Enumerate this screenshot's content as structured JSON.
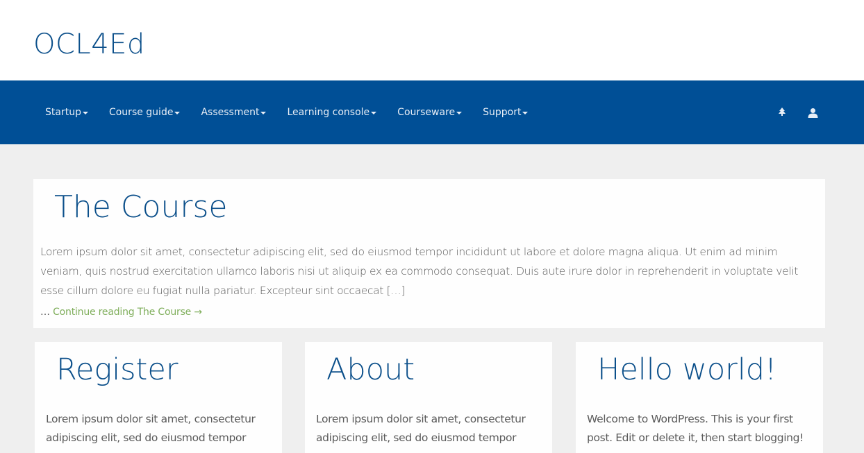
{
  "site": {
    "title": "OCL4Ed"
  },
  "nav": {
    "items": [
      {
        "label": "Startup"
      },
      {
        "label": "Course guide"
      },
      {
        "label": "Assessment"
      },
      {
        "label": "Learning console"
      },
      {
        "label": "Courseware"
      },
      {
        "label": "Support"
      }
    ],
    "icons": [
      "tree-icon",
      "user-icon"
    ]
  },
  "main_post": {
    "title": "The Course",
    "excerpt": "Lorem ipsum dolor sit amet, consectetur adipiscing elit, sed do eiusmod tempor incididunt ut labore et dolore magna aliqua. Ut enim ad minim veniam, quis nostrud exercitation ullamco laboris nisi ut aliquip ex ea commodo consequat. Duis aute irure dolor in reprehenderit in voluptate velit esse cillum dolore eu fugiat nulla pariatur. Excepteur sint occaecat […]",
    "ellipsis": "…",
    "more_link": "Continue reading The Course →"
  },
  "cards": [
    {
      "title": "Register",
      "excerpt": "Lorem ipsum dolor sit amet, consectetur adipiscing elit, sed do eiusmod tempor"
    },
    {
      "title": "About",
      "excerpt": "Lorem ipsum dolor sit amet, consectetur adipiscing elit, sed do eiusmod tempor"
    },
    {
      "title": "Hello world!",
      "excerpt": "Welcome to WordPress. This is your first post. Edit or delete it, then start blogging!"
    }
  ],
  "colors": {
    "nav_bg": "#004f96",
    "title_blue": "#0b4f8a",
    "link_green": "#7fae5b",
    "page_bg": "#efefef"
  }
}
